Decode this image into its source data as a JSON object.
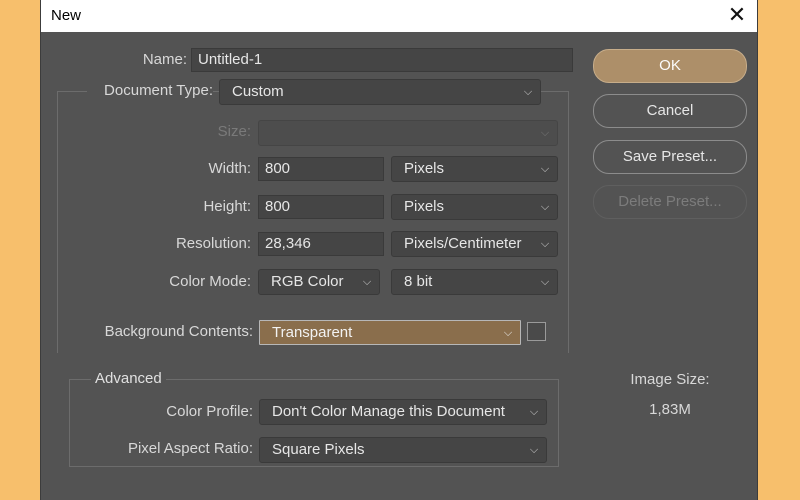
{
  "dialog": {
    "title": "New",
    "close_glyph": "✕"
  },
  "form": {
    "name_label": "Name:",
    "name_value": "Untitled-1",
    "document_type_label": "Document Type:",
    "document_type_value": "Custom",
    "size_label": "Size:",
    "size_value": "",
    "width_label": "Width:",
    "width_value": "800",
    "width_unit": "Pixels",
    "height_label": "Height:",
    "height_value": "800",
    "height_unit": "Pixels",
    "resolution_label": "Resolution:",
    "resolution_value": "28,346",
    "resolution_unit": "Pixels/Centimeter",
    "color_mode_label": "Color Mode:",
    "color_mode_value": "RGB Color",
    "bit_depth_value": "8 bit",
    "background_label": "Background Contents:",
    "background_value": "Transparent"
  },
  "advanced": {
    "title": "Advanced",
    "color_profile_label": "Color Profile:",
    "color_profile_value": "Don't Color Manage this Document",
    "pixel_aspect_label": "Pixel Aspect Ratio:",
    "pixel_aspect_value": "Square Pixels"
  },
  "buttons": {
    "ok": "OK",
    "cancel": "Cancel",
    "save_preset": "Save Preset...",
    "delete_preset": "Delete Preset..."
  },
  "info": {
    "image_size_label": "Image Size:",
    "image_size_value": "1,83M"
  },
  "icons": {
    "chevron": "⌵"
  },
  "colors": {
    "accent": "#ad8f69",
    "background": "#f7bf6c",
    "dialog": "#535353"
  }
}
